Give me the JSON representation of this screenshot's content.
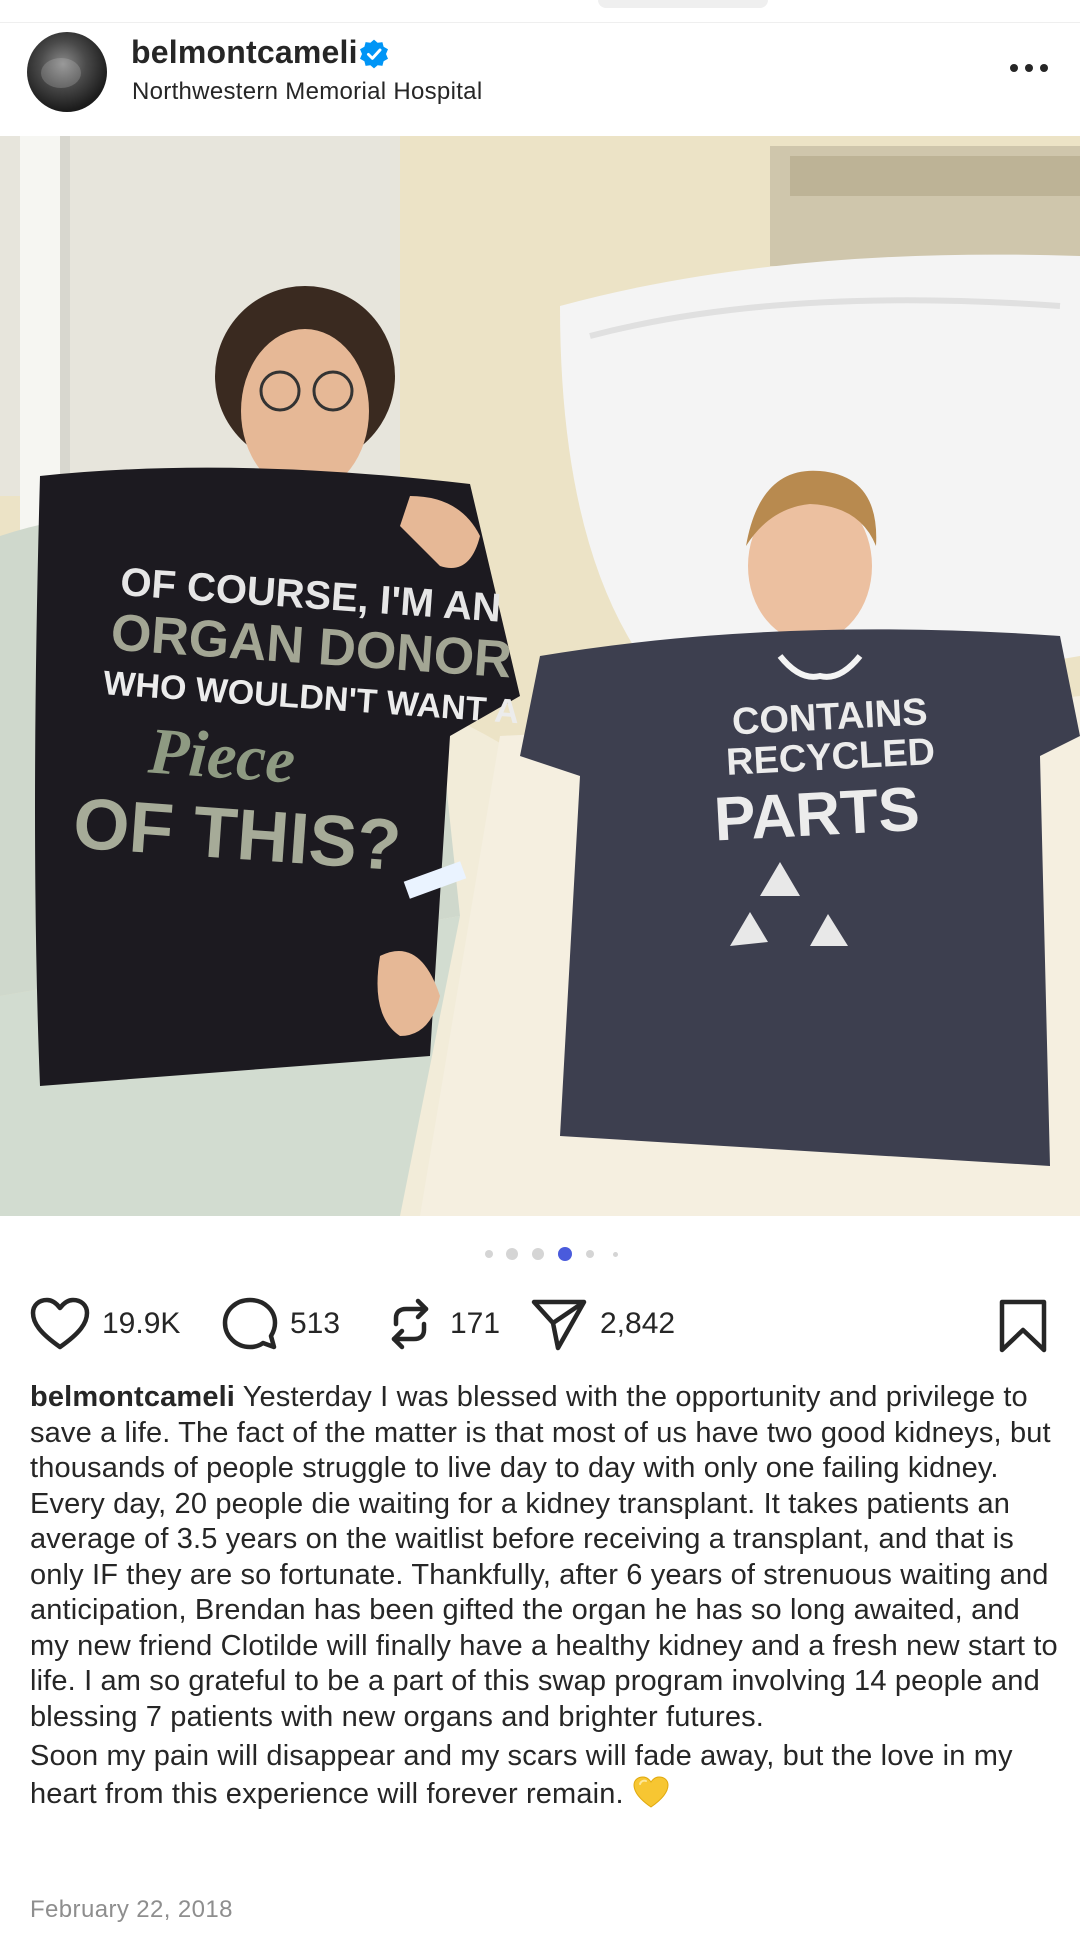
{
  "post": {
    "username": "belmontcameli",
    "location": "Northwestern Memorial Hospital",
    "verified": true,
    "date": "February 22, 2018"
  },
  "photo": {
    "left_shirt_lines": [
      "OF COURSE, I'M AN",
      "ORGAN DONOR",
      "WHO WOULDN'T WANT A",
      "Piece",
      "OF THIS?"
    ],
    "right_shirt_lines": [
      "CONTAINS",
      "RECYCLED",
      "PARTS"
    ]
  },
  "carousel": {
    "total": 6,
    "active": 4
  },
  "stats": {
    "likes": "19.9K",
    "comments": "513",
    "reposts": "171",
    "shares": "2,842"
  },
  "caption": {
    "username": "belmontcameli",
    "paragraph1": "Yesterday I was blessed with the opportunity and privilege to save a life. The fact of the matter is that most of us have two good kidneys, but thousands of people struggle to live day to day with only one failing kidney. Every day, 20 people die waiting for a kidney transplant. It takes patients an average of 3.5 years on the waitlist before receiving a transplant, and that is only IF they are so fortunate. Thankfully, after 6 years of strenuous waiting and anticipation, Brendan has been gifted the organ he has so long awaited, and my new friend Clotilde will finally have a healthy kidney and a fresh new start to life. I am so grateful to be a part of this swap program involving 14 people and blessing 7 patients with new organs and brighter futures.",
    "paragraph2": "Soon my pain will disappear and my scars will fade away, but the love in my heart from this experience will forever remain.",
    "emoji": "yellow-heart"
  },
  "colors": {
    "text": "#262626",
    "muted": "#8e8e8e",
    "verified": "#0095f6",
    "active_dot": "#4a5bdc"
  }
}
